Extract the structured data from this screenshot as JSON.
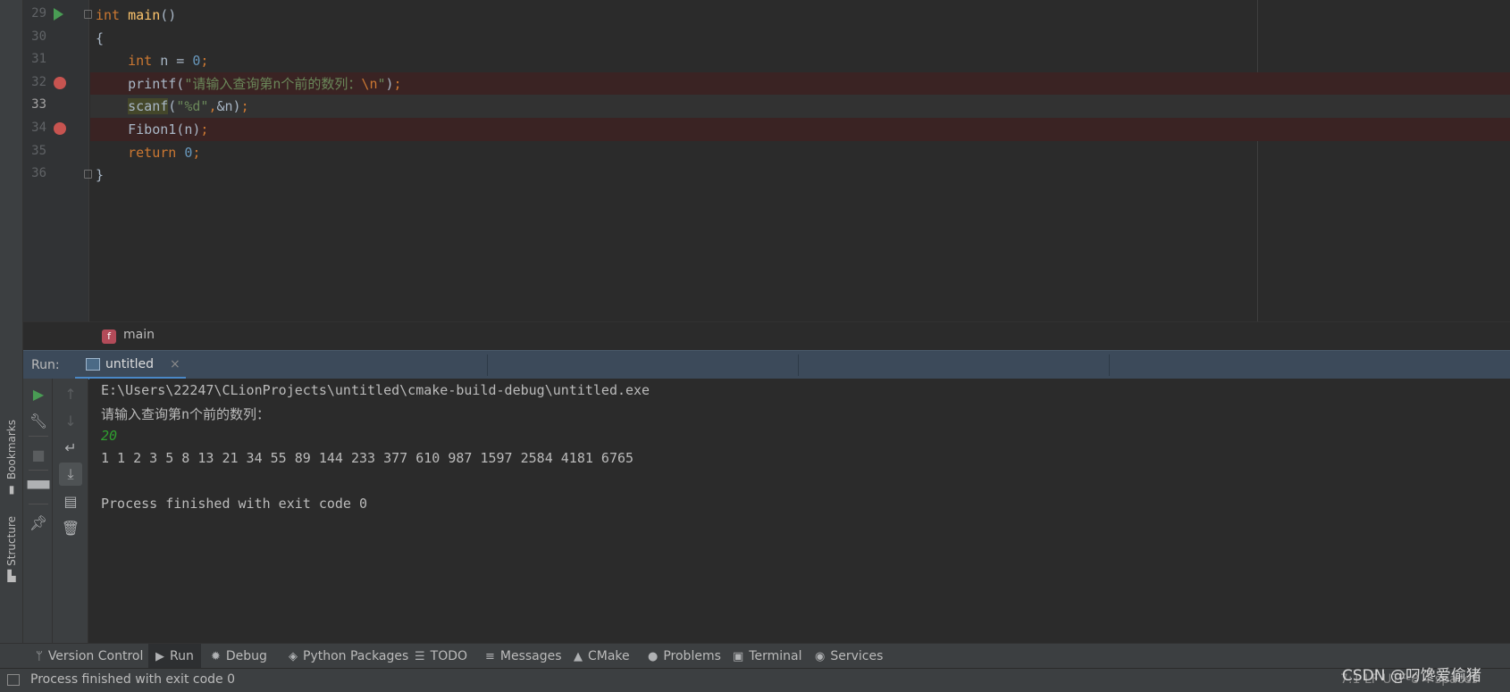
{
  "left_strip": {
    "bookmarks_label": "Bookmarks",
    "structure_label": "Structure"
  },
  "editor": {
    "lines": [
      {
        "number": "29",
        "gutter": "run",
        "tokens": [
          [
            "kw",
            "int "
          ],
          [
            "fn",
            "main"
          ],
          [
            "plain",
            "()"
          ]
        ]
      },
      {
        "number": "30",
        "gutter": "",
        "tokens": [
          [
            "plain",
            "{"
          ]
        ]
      },
      {
        "number": "31",
        "gutter": "",
        "tokens": [
          [
            "plain",
            "    "
          ],
          [
            "kw",
            "int "
          ],
          [
            "plain",
            "n = "
          ],
          [
            "num",
            "0"
          ],
          [
            "kw",
            ";"
          ]
        ]
      },
      {
        "number": "32",
        "gutter": "breakpoint",
        "tokens": [
          [
            "plain",
            "    printf("
          ],
          [
            "str",
            "\"请输入查询第n个前的数列："
          ],
          [
            "kw",
            "\\n"
          ],
          [
            "str",
            "\""
          ],
          [
            "plain",
            ")"
          ],
          [
            "kw",
            ";"
          ]
        ]
      },
      {
        "number": "33",
        "gutter": "",
        "tokens": [
          [
            "plain",
            "    "
          ],
          [
            "hl",
            "scanf"
          ],
          [
            "plain",
            "("
          ],
          [
            "str",
            "\"%d\""
          ],
          [
            "kw",
            ","
          ],
          [
            "plain",
            "&n)"
          ],
          [
            "kw",
            ";"
          ]
        ]
      },
      {
        "number": "34",
        "gutter": "breakpoint",
        "tokens": [
          [
            "plain",
            "    Fibon1(n)"
          ],
          [
            "kw",
            ";"
          ]
        ]
      },
      {
        "number": "35",
        "gutter": "",
        "tokens": [
          [
            "plain",
            "    "
          ],
          [
            "kw",
            "return "
          ],
          [
            "num",
            "0"
          ],
          [
            "kw",
            ";"
          ]
        ]
      },
      {
        "number": "36",
        "gutter": "",
        "tokens": [
          [
            "plain",
            "}"
          ]
        ]
      }
    ],
    "current_line": "33"
  },
  "breadcrumb": {
    "icon_letter": "f",
    "label": "main"
  },
  "run_panel": {
    "label": "Run:",
    "tab_label": "untitled",
    "tab_close": "×"
  },
  "console": {
    "lines": [
      {
        "text": "E:\\Users\\22247\\CLionProjects\\untitled\\cmake-build-debug\\untitled.exe",
        "kind": "output"
      },
      {
        "text": "请输入查询第n个前的数列：",
        "kind": "output"
      },
      {
        "text": "20",
        "kind": "input"
      },
      {
        "text": "1 1 2 3 5 8 13 21 34 55 89 144 233 377 610 987 1597 2584 4181 6765",
        "kind": "output"
      },
      {
        "text": "",
        "kind": "output"
      },
      {
        "text": "Process finished with exit code 0",
        "kind": "output"
      }
    ]
  },
  "tool_tabs": [
    {
      "label": "Version Control",
      "icon": "branch-icon",
      "glyph": "ᛘ"
    },
    {
      "label": "Run",
      "icon": "play-icon",
      "glyph": "▶",
      "active": true
    },
    {
      "label": "Debug",
      "icon": "bug-icon",
      "glyph": "✹"
    },
    {
      "label": "Python Packages",
      "icon": "layers-icon",
      "glyph": "◈"
    },
    {
      "label": "TODO",
      "icon": "list-icon",
      "glyph": "☰"
    },
    {
      "label": "Messages",
      "icon": "messages-icon",
      "glyph": "≡"
    },
    {
      "label": "CMake",
      "icon": "cmake-icon",
      "glyph": "▲"
    },
    {
      "label": "Problems",
      "icon": "problems-icon",
      "glyph": "●"
    },
    {
      "label": "Terminal",
      "icon": "terminal-icon",
      "glyph": "▣"
    },
    {
      "label": "Services",
      "icon": "services-icon",
      "glyph": "◉"
    }
  ],
  "status_bar": {
    "message": "Process finished with exit code 0",
    "right_info": "7:1  LF  UTF-8  4 spaces"
  },
  "watermark": "CSDN @叼馋爱偷猪",
  "colors": {
    "keyword": "#cc7832",
    "function": "#ffc66d",
    "string": "#6a8759",
    "number": "#6897bb",
    "breakpoint": "#c75450",
    "console_input": "#2f9d2f",
    "run_tab_accent": "#4a88c7"
  }
}
